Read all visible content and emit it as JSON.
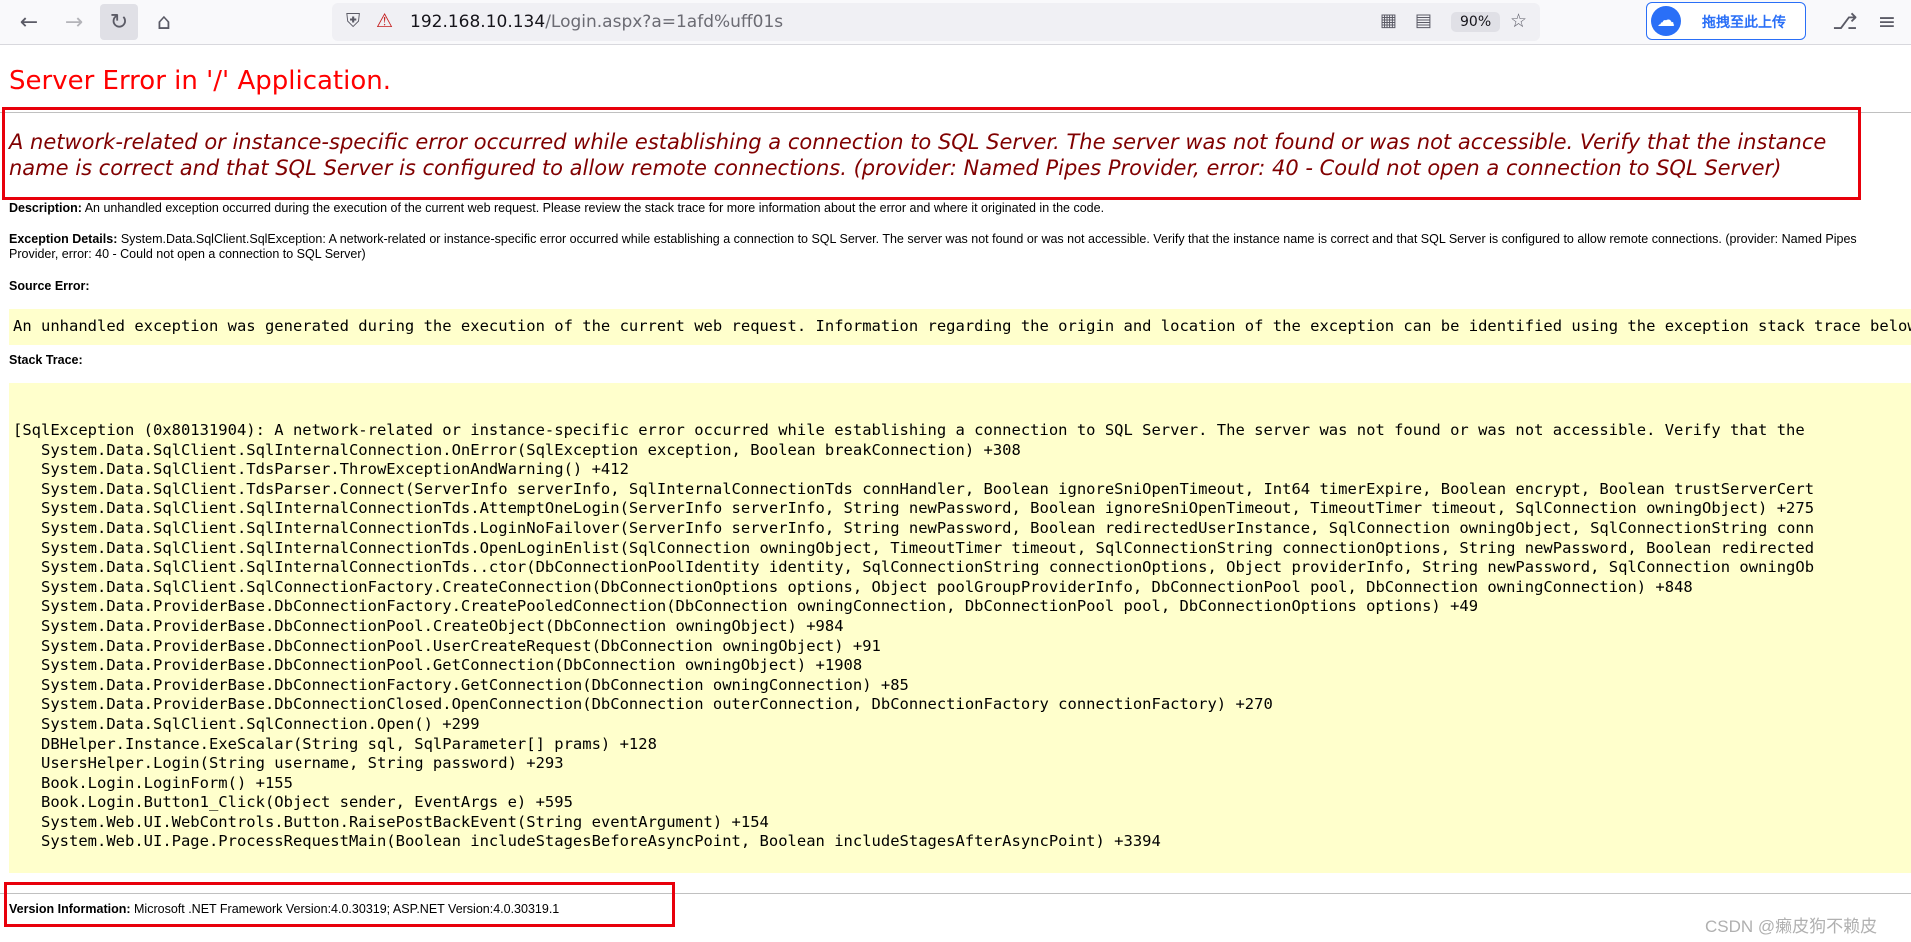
{
  "browser": {
    "url_host": "192.168.10.134",
    "url_path": "/Login.aspx?a=1afd%uff01s",
    "zoom": "90%",
    "extension_label": "拖拽至此上传"
  },
  "page": {
    "heading": "Server Error in '/' Application.",
    "error_message": "A network-related or instance-specific error occurred while establishing a connection to SQL Server. The server was not found or was not accessible. Verify that the instance name is correct and that SQL Server is configured to allow remote connections. (provider: Named Pipes Provider, error: 40 - Could not open a connection to SQL Server)",
    "description_label": "Description:",
    "description_text": " An unhandled exception occurred during the execution of the current web request. Please review the stack trace for more information about the error and where it originated in the code.",
    "exception_label": "Exception Details:",
    "exception_text": " System.Data.SqlClient.SqlException: A network-related or instance-specific error occurred while establishing a connection to SQL Server. The server was not found or was not accessible. Verify that the instance name is correct and that SQL Server is configured to allow remote connections. (provider: Named Pipes Provider, error: 40 - Could not open a connection to SQL Server)",
    "source_error_label": "Source Error:",
    "source_error_text": "An unhandled exception was generated during the execution of the current web request. Information regarding the origin and location of the exception can be identified using the exception stack trace below.",
    "stack_trace_label": "Stack Trace:",
    "stack_trace": [
      "[SqlException (0x80131904): A network-related or instance-specific error occurred while establishing a connection to SQL Server. The server was not found or was not accessible. Verify that the",
      "System.Data.SqlClient.SqlInternalConnection.OnError(SqlException exception, Boolean breakConnection) +308",
      "System.Data.SqlClient.TdsParser.ThrowExceptionAndWarning() +412",
      "System.Data.SqlClient.TdsParser.Connect(ServerInfo serverInfo, SqlInternalConnectionTds connHandler, Boolean ignoreSniOpenTimeout, Int64 timerExpire, Boolean encrypt, Boolean trustServerCert",
      "System.Data.SqlClient.SqlInternalConnectionTds.AttemptOneLogin(ServerInfo serverInfo, String newPassword, Boolean ignoreSniOpenTimeout, TimeoutTimer timeout, SqlConnection owningObject) +275",
      "System.Data.SqlClient.SqlInternalConnectionTds.LoginNoFailover(ServerInfo serverInfo, String newPassword, Boolean redirectedUserInstance, SqlConnection owningObject, SqlConnectionString conn",
      "System.Data.SqlClient.SqlInternalConnectionTds.OpenLoginEnlist(SqlConnection owningObject, TimeoutTimer timeout, SqlConnectionString connectionOptions, String newPassword, Boolean redirected",
      "System.Data.SqlClient.SqlInternalConnectionTds..ctor(DbConnectionPoolIdentity identity, SqlConnectionString connectionOptions, Object providerInfo, String newPassword, SqlConnection owningOb",
      "System.Data.SqlClient.SqlConnectionFactory.CreateConnection(DbConnectionOptions options, Object poolGroupProviderInfo, DbConnectionPool pool, DbConnection owningConnection) +848",
      "System.Data.ProviderBase.DbConnectionFactory.CreatePooledConnection(DbConnection owningConnection, DbConnectionPool pool, DbConnectionOptions options) +49",
      "System.Data.ProviderBase.DbConnectionPool.CreateObject(DbConnection owningObject) +984",
      "System.Data.ProviderBase.DbConnectionPool.UserCreateRequest(DbConnection owningObject) +91",
      "System.Data.ProviderBase.DbConnectionPool.GetConnection(DbConnection owningObject) +1908",
      "System.Data.ProviderBase.DbConnectionFactory.GetConnection(DbConnection owningConnection) +85",
      "System.Data.ProviderBase.DbConnectionClosed.OpenConnection(DbConnection outerConnection, DbConnectionFactory connectionFactory) +270",
      "System.Data.SqlClient.SqlConnection.Open() +299",
      "DBHelper.Instance.ExeScalar(String sql, SqlParameter[] prams) +128",
      "UsersHelper.Login(String username, String password) +293",
      "Book.Login.LoginForm() +155",
      "Book.Login.Button1_Click(Object sender, EventArgs e) +595",
      "System.Web.UI.WebControls.Button.RaisePostBackEvent(String eventArgument) +154",
      "System.Web.UI.Page.ProcessRequestMain(Boolean includeStagesBeforeAsyncPoint, Boolean includeStagesAfterAsyncPoint) +3394"
    ],
    "version_label": "Version Information:",
    "version_text": " Microsoft .NET Framework Version:4.0.30319; ASP.NET Version:4.0.30319.1"
  },
  "watermark": "CSDN @癞皮狗不赖皮",
  "colors": {
    "heading": "#ff0000",
    "error_message": "#800000",
    "code_background": "#ffffcc",
    "highlight_box": "#e8000b",
    "extension_accent": "#2a6ff7"
  },
  "icons": {
    "back": "arrow-left-icon",
    "forward": "arrow-right-icon",
    "reload": "reload-icon",
    "home": "home-icon",
    "tracking_protection": "shield-icon",
    "connection": "insecure-lock-icon",
    "qr": "qr-code-icon",
    "reader": "reader-view-icon",
    "bookmark": "star-icon",
    "extensions": "puzzle-icon",
    "menu": "hamburger-menu-icon"
  }
}
